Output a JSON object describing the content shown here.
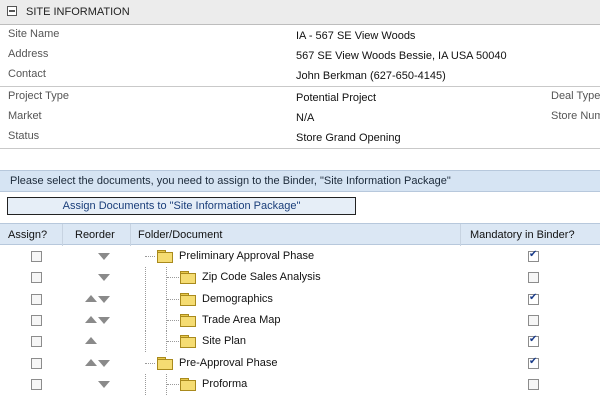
{
  "panel": {
    "title": "SITE INFORMATION",
    "icon": "collapse-icon"
  },
  "site_info": [
    {
      "label": "Site Name",
      "value": "IA - 567 SE View Woods"
    },
    {
      "label": "Address",
      "value": "567 SE View Woods Bessie, IA USA 50040"
    },
    {
      "label": "Contact",
      "value": "John Berkman (627-650-4145)"
    }
  ],
  "project_info": [
    {
      "label": "Project Type",
      "value": "Potential Project",
      "extra_label": "Deal Type"
    },
    {
      "label": "Market",
      "value": "N/A",
      "extra_label": "Store Num"
    },
    {
      "label": "Status",
      "value": "Store Grand Opening",
      "extra_label": ""
    }
  ],
  "instructions": "Please select the documents, you need to assign to the Binder, \"Site Information Package\"",
  "assign_button": "Assign Documents to \"Site Information Package\"",
  "table": {
    "headers": {
      "assign": "Assign?",
      "reorder": "Reorder",
      "folder": "Folder/Document",
      "mandatory": "Mandatory in Binder?"
    },
    "rows": [
      {
        "name": "Preliminary Approval Phase",
        "level": 0,
        "assign": false,
        "up": false,
        "down": true,
        "mandatory": true
      },
      {
        "name": "Zip Code Sales Analysis",
        "level": 1,
        "assign": false,
        "up": false,
        "down": true,
        "mandatory": false
      },
      {
        "name": "Demographics",
        "level": 1,
        "assign": false,
        "up": true,
        "down": true,
        "mandatory": true
      },
      {
        "name": "Trade Area Map",
        "level": 1,
        "assign": false,
        "up": true,
        "down": true,
        "mandatory": false
      },
      {
        "name": "Site Plan",
        "level": 1,
        "assign": false,
        "up": true,
        "down": false,
        "mandatory": true
      },
      {
        "name": "Pre-Approval Phase",
        "level": 0,
        "assign": false,
        "up": true,
        "down": true,
        "mandatory": true
      },
      {
        "name": "Proforma",
        "level": 1,
        "assign": false,
        "up": false,
        "down": true,
        "mandatory": false
      }
    ]
  },
  "colors": {
    "header_blue": "#d6e4f3",
    "folder": "#f5dc72",
    "check": "#1a3c8a"
  }
}
